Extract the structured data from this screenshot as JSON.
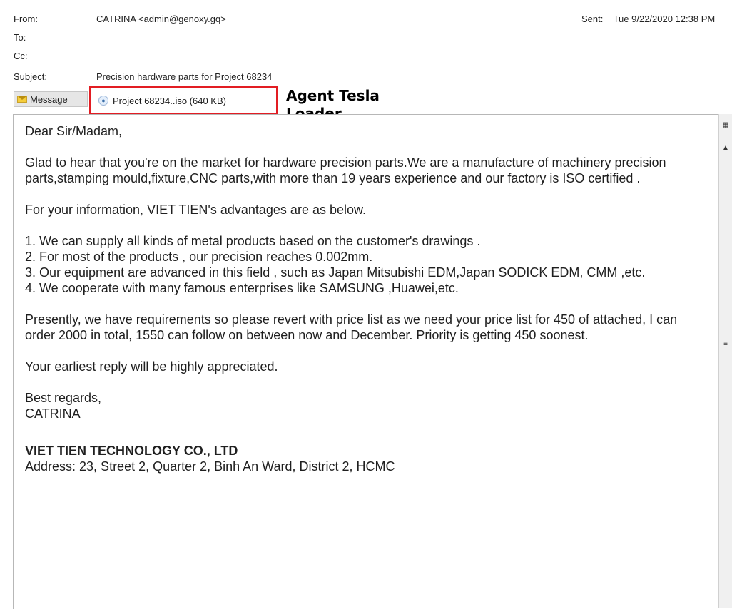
{
  "header": {
    "from_label": "From:",
    "from_value": "CATRINA <admin@genoxy.gq>",
    "sent_label": "Sent:",
    "sent_value": "Tue 9/22/2020 12:38 PM",
    "to_label": "To:",
    "cc_label": "Cc:",
    "subject_label": "Subject:",
    "subject_value": "Precision hardware parts for Project 68234"
  },
  "tabs": {
    "message_label": "Message",
    "attachment_label": "Project 68234..iso (640 KB)"
  },
  "annotation": {
    "line1": "Agent Tesla",
    "line2": "Loader"
  },
  "body": {
    "greeting": "Dear Sir/Madam,",
    "para1": "Glad to hear that you're on the market for hardware precision parts.We are a manufacture of machinery precision parts,stamping mould,fixture,CNC parts,with more than 19 years experience and our factory is ISO certified .",
    "para2": "For your information, VIET TIEN's advantages are as below.",
    "list": [
      "1. We can supply all kinds of metal products based on the customer's drawings .",
      "2. For most of the products , our precision reaches 0.002mm.",
      "3. Our equipment are advanced in this field , such as Japan Mitsubishi EDM,Japan SODICK EDM, CMM ,etc.",
      "4. We cooperate with many famous enterprises like SAMSUNG ,Huawei,etc."
    ],
    "para3": "Presently, we have requirements so please revert with price list as we need your price list for 450 of attached, I can order 2000 in total, 1550 can follow on between now and December. Priority is getting 450 soonest.",
    "para4": "Your earliest reply will be highly appreciated.",
    "closing": "Best regards,",
    "signer": "CATRINA",
    "company": "VIET TIEN TECHNOLOGY CO., LTD",
    "address": "Address: 23, Street 2, Quarter 2, Binh An Ward, District 2, HCMC"
  },
  "colors": {
    "annotation_border": "#e21d23",
    "tab_bg": "#e6e6e6"
  }
}
